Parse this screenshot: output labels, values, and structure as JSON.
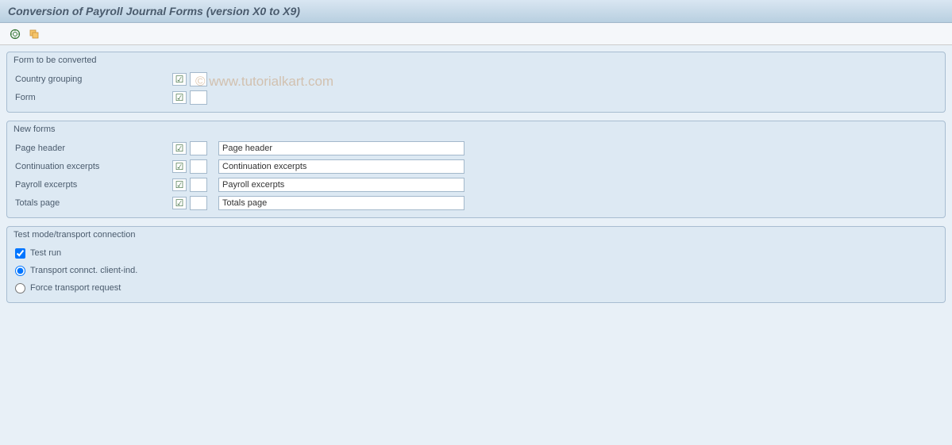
{
  "title": "Conversion of Payroll Journal Forms (version X0 to X9)",
  "watermark": "© www.tutorialkart.com",
  "group1": {
    "title": "Form to be converted",
    "country_grouping_label": "Country grouping",
    "form_label": "Form"
  },
  "group2": {
    "title": "New forms",
    "page_header_label": "Page header",
    "page_header_value": "Page header",
    "continuation_label": "Continuation excerpts",
    "continuation_value": "Continuation excerpts",
    "payroll_label": "Payroll excerpts",
    "payroll_value": "Payroll excerpts",
    "totals_label": "Totals page",
    "totals_value": "Totals page"
  },
  "group3": {
    "title": "Test mode/transport connection",
    "test_run_label": "Test run",
    "transport_client_label": "Transport connct. client-ind.",
    "force_transport_label": "Force transport request"
  }
}
